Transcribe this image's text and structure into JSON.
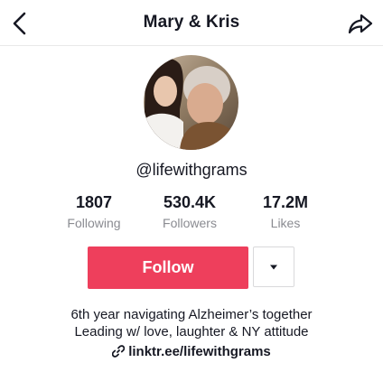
{
  "header": {
    "title": "Mary & Kris",
    "back_icon": "chevron-left-icon",
    "share_icon": "share-arrow-icon"
  },
  "profile": {
    "username": "@lifewithgrams",
    "avatar_icon": "profile-photo"
  },
  "stats": [
    {
      "value": "1807",
      "label": "Following"
    },
    {
      "value": "530.4K",
      "label": "Followers"
    },
    {
      "value": "17.2M",
      "label": "Likes"
    }
  ],
  "actions": {
    "follow_label": "Follow",
    "more_icon": "caret-down-icon",
    "follow_color": "#ee3f5c"
  },
  "bio": {
    "line1": "6th year navigating Alzheimer’s together",
    "line2": "Leading w/ love, laughter & NY attitude",
    "link": "linktr.ee/lifewithgrams",
    "link_icon": "link-icon"
  }
}
